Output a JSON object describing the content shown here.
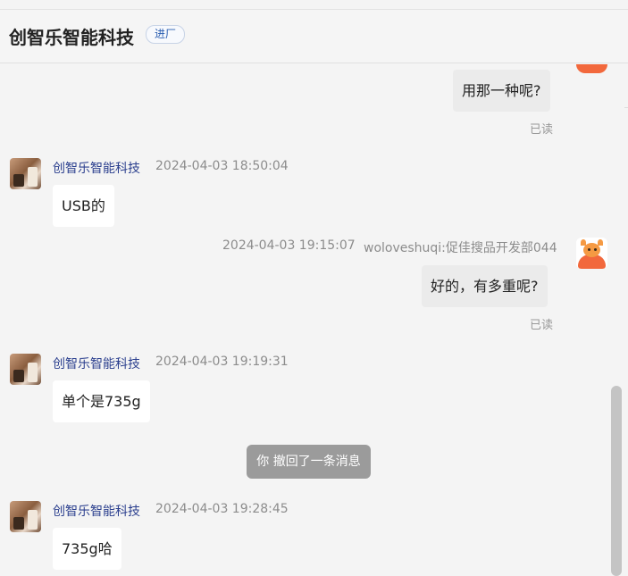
{
  "header": {
    "title": "创智乐智能科技",
    "tag": "进厂"
  },
  "messages": {
    "m1": {
      "text": "用那一种呢?",
      "read": "已读"
    },
    "m2": {
      "sender": "创智乐智能科技",
      "time": "2024-04-03 18:50:04",
      "text": "USB的"
    },
    "m3": {
      "time": "2024-04-03 19:15:07",
      "sender": "woloveshuqi:促佳搜品开发部044",
      "text": "好的，有多重呢?",
      "read": "已读"
    },
    "m4": {
      "sender": "创智乐智能科技",
      "time": "2024-04-03 19:19:31",
      "text": "单个是735g"
    },
    "system": {
      "text": "你 撤回了一条消息"
    },
    "m5": {
      "sender": "创智乐智能科技",
      "time": "2024-04-03 19:28:45",
      "text": "735g哈"
    }
  }
}
